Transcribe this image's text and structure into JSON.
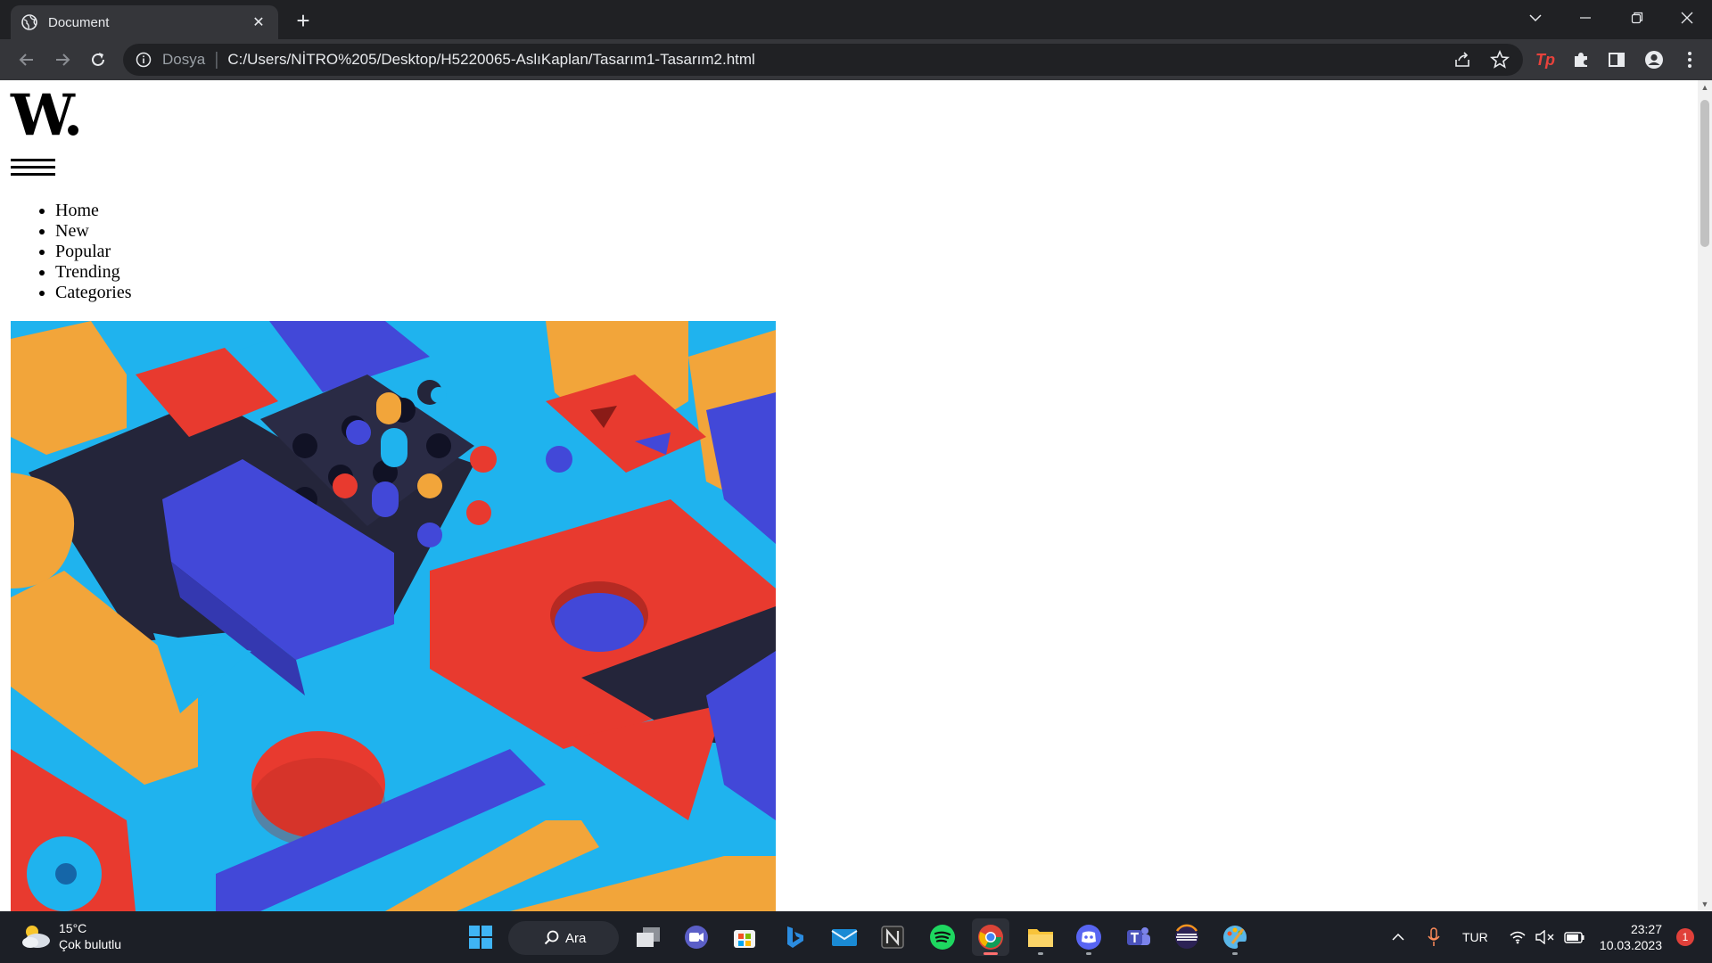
{
  "browser": {
    "tab": {
      "title": "Document"
    },
    "omnibox": {
      "scheme_label": "Dosya",
      "url": "C:/Users/NİTRO%205/Desktop/H5220065-AslıKaplan/Tasarım1-Tasarım2.html"
    },
    "extension_label": "Tp"
  },
  "page": {
    "logo": "W.",
    "menu": [
      "Home",
      "New",
      "Popular",
      "Trending",
      "Categories"
    ]
  },
  "taskbar": {
    "weather": {
      "temp": "15°C",
      "condition": "Çok bulutlu"
    },
    "search_label": "Ara",
    "language": "TUR",
    "time": "23:27",
    "date": "10.03.2023",
    "notification_count": "1"
  },
  "colors": {
    "tab_active": "#35363a",
    "frame": "#202124",
    "taskbar": "#1c1f26",
    "hero_blue": "#1fb3ee",
    "hero_red": "#e83a2f",
    "hero_orange": "#f2a53a",
    "hero_indigo": "#4248d8",
    "hero_dark": "#24253a"
  }
}
